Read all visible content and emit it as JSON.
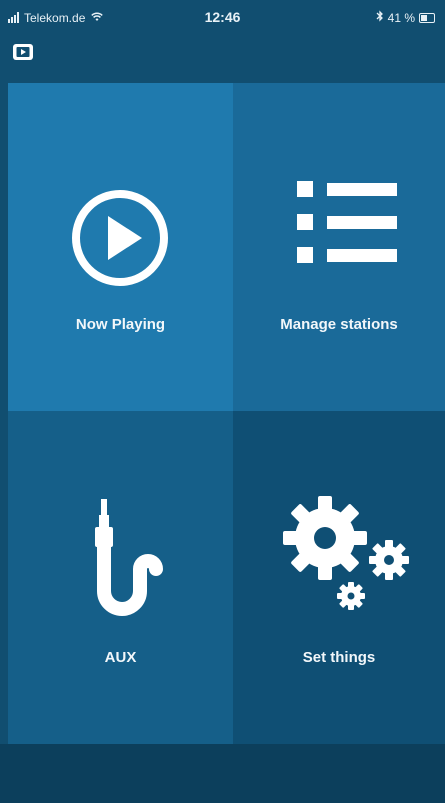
{
  "status_bar": {
    "carrier": "Telekom.de",
    "time": "12:46",
    "battery": "41 %"
  },
  "tiles": [
    {
      "label": "Now Playing",
      "icon": "play-circle-icon"
    },
    {
      "label": "Manage stations",
      "icon": "list-icon"
    },
    {
      "label": "AUX",
      "icon": "aux-cable-icon"
    },
    {
      "label": "Set things",
      "icon": "gears-icon"
    }
  ],
  "colors": {
    "background": "#114e70",
    "tile_now_playing": "#1f7aae",
    "tile_manage": "#1a6a99",
    "tile_aux": "#155f89",
    "tile_set": "#0f4f74",
    "icon": "#ffffff"
  }
}
